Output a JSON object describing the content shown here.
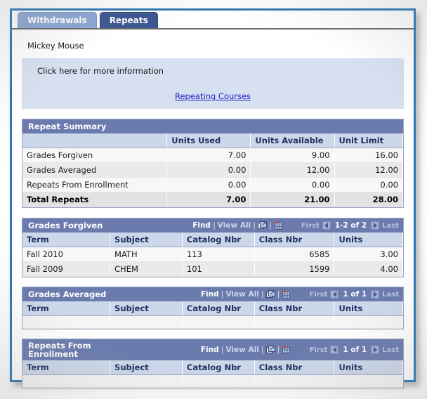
{
  "window": {
    "tabs": [
      {
        "label": "Withdrawals",
        "active": false
      },
      {
        "label": "Repeats",
        "active": true
      }
    ]
  },
  "student": {
    "name": "Mickey Mouse"
  },
  "info_panel": {
    "text": "Click here for more information",
    "link_label": "Repeating Courses"
  },
  "nav_labels": {
    "find": "Find",
    "separator": "|",
    "view_all": "View All",
    "first": "First",
    "last": "Last",
    "new_window_icon": "new-window-icon",
    "download_grid_icon": "download-spreadsheet-icon",
    "prev_icon": "previous-arrow-icon",
    "next_icon": "next-arrow-icon"
  },
  "summary": {
    "title": "Repeat Summary",
    "columns": [
      "",
      "Units Used",
      "Units Available",
      "Unit Limit"
    ],
    "rows": [
      {
        "label": "Grades Forgiven",
        "units_used": "7.00",
        "units_available": "9.00",
        "unit_limit": "16.00",
        "total": false
      },
      {
        "label": "Grades Averaged",
        "units_used": "0.00",
        "units_available": "12.00",
        "unit_limit": "12.00",
        "total": false
      },
      {
        "label": "Repeats From Enrollment",
        "units_used": "0.00",
        "units_available": "0.00",
        "unit_limit": "0.00",
        "total": false
      },
      {
        "label": "Total Repeats",
        "units_used": "7.00",
        "units_available": "21.00",
        "unit_limit": "28.00",
        "total": true
      }
    ]
  },
  "grids": [
    {
      "title": "Grades Forgiven",
      "two_line": false,
      "count_label": "1-2 of 2",
      "columns": [
        "Term",
        "Subject",
        "Catalog Nbr",
        "Class Nbr",
        "Units"
      ],
      "rows": [
        {
          "term": "Fall 2010",
          "subject": "MATH",
          "catalog_nbr": "113",
          "class_nbr": "6585",
          "units": "3.00"
        },
        {
          "term": "Fall 2009",
          "subject": "CHEM",
          "catalog_nbr": "101",
          "class_nbr": "1599",
          "units": "4.00"
        }
      ]
    },
    {
      "title": "Grades Averaged",
      "two_line": false,
      "count_label": "1 of 1",
      "columns": [
        "Term",
        "Subject",
        "Catalog Nbr",
        "Class Nbr",
        "Units"
      ],
      "rows": [
        {
          "term": "",
          "subject": "",
          "catalog_nbr": "",
          "class_nbr": "",
          "units": ""
        }
      ]
    },
    {
      "title": "Repeats From\nEnrollment",
      "two_line": true,
      "count_label": "1 of 1",
      "columns": [
        "Term",
        "Subject",
        "Catalog Nbr",
        "Class Nbr",
        "Units"
      ],
      "rows": [
        {
          "term": "",
          "subject": "",
          "catalog_nbr": "",
          "class_nbr": "",
          "units": ""
        }
      ]
    }
  ],
  "colors": {
    "window_border": "#2b77b5",
    "tab_active": "#3b5791",
    "tab_inactive": "#8ba7d4",
    "grid_title_bar": "#6b7bae",
    "grid_header": "#ccd8ea",
    "info_panel": "#d6e0f0",
    "link": "#2020c8"
  }
}
